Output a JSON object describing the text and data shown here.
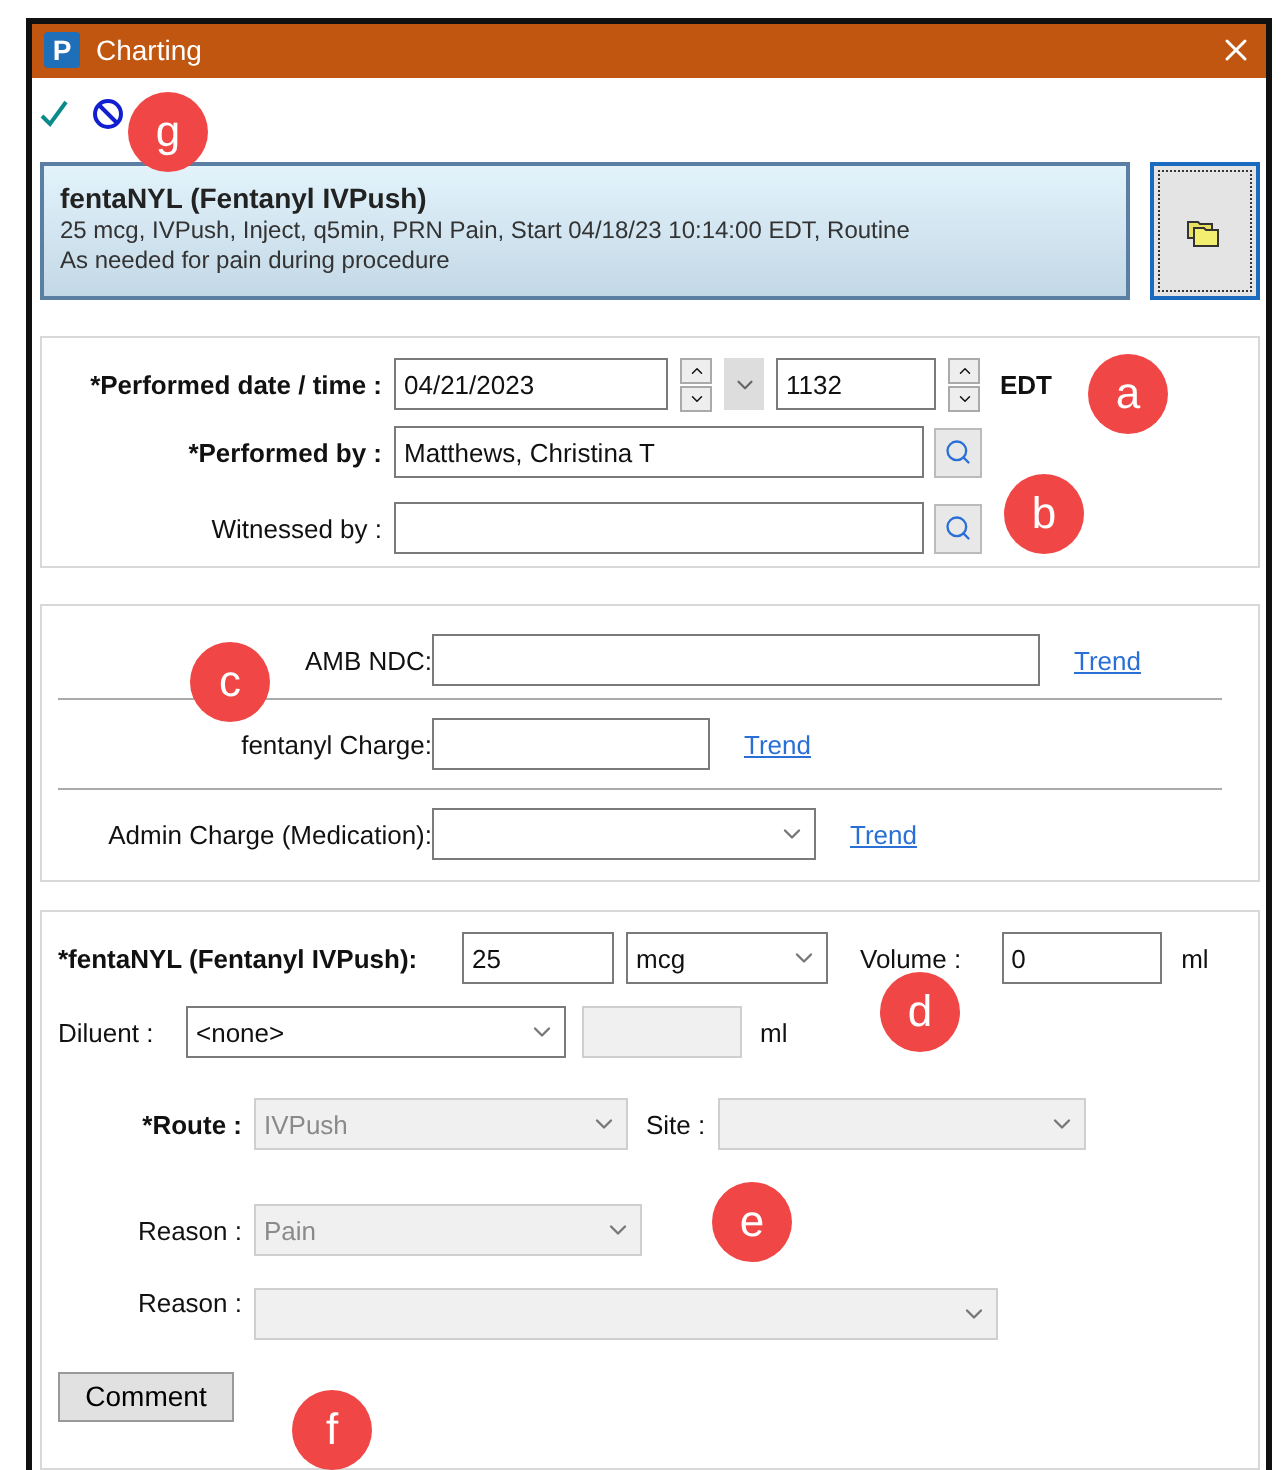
{
  "window": {
    "app_letter": "P",
    "title": "Charting"
  },
  "toolbar": [
    {
      "kind": "check"
    },
    {
      "kind": "cancel"
    }
  ],
  "order": {
    "title": "fentaNYL (Fentanyl IVPush)",
    "details": "25 mcg, IVPush, Inject, q5min, PRN Pain, Start 04/18/23 10:14:00 EDT, Routine",
    "note": "As needed for pain during procedure"
  },
  "performed": {
    "label": "*Performed date / time :",
    "required": true,
    "date": "04/21/2023",
    "time": "1132",
    "zone": "EDT"
  },
  "people": [
    {
      "label": "*Performed by :",
      "required": true,
      "value": "Matthews, Christina T"
    },
    {
      "label": "Witnessed by :",
      "required": false
    }
  ],
  "charges": [
    {
      "label": "AMB NDC:",
      "kind": "text",
      "link": "Trend"
    },
    {
      "label": "fentanyl Charge:",
      "kind": "text",
      "link": "Trend"
    },
    {
      "label": "Admin Charge (Medication):",
      "kind": "dropdown",
      "link": "Trend"
    }
  ],
  "dose": {
    "label": "*fentaNYL (Fentanyl IVPush):",
    "required": true,
    "amount": "25",
    "unit": "mcg",
    "volume_label": "Volume :",
    "volume": "0",
    "volume_unit": "ml"
  },
  "diluent": {
    "label": "Diluent :",
    "value": "<none>",
    "volume_disabled": true,
    "unit": "ml"
  },
  "route": {
    "label": "*Route :",
    "required": true,
    "value": "IVPush",
    "disabled": true
  },
  "site": {
    "label": "Site :",
    "disabled": true
  },
  "reasons": [
    {
      "label": "Reason :",
      "value": "Pain",
      "disabled": true
    },
    {
      "label": "Reason :",
      "disabled": true
    }
  ],
  "comment_button": "Comment",
  "callouts": [
    "g",
    "a",
    "b",
    "c",
    "d",
    "e",
    "f"
  ]
}
